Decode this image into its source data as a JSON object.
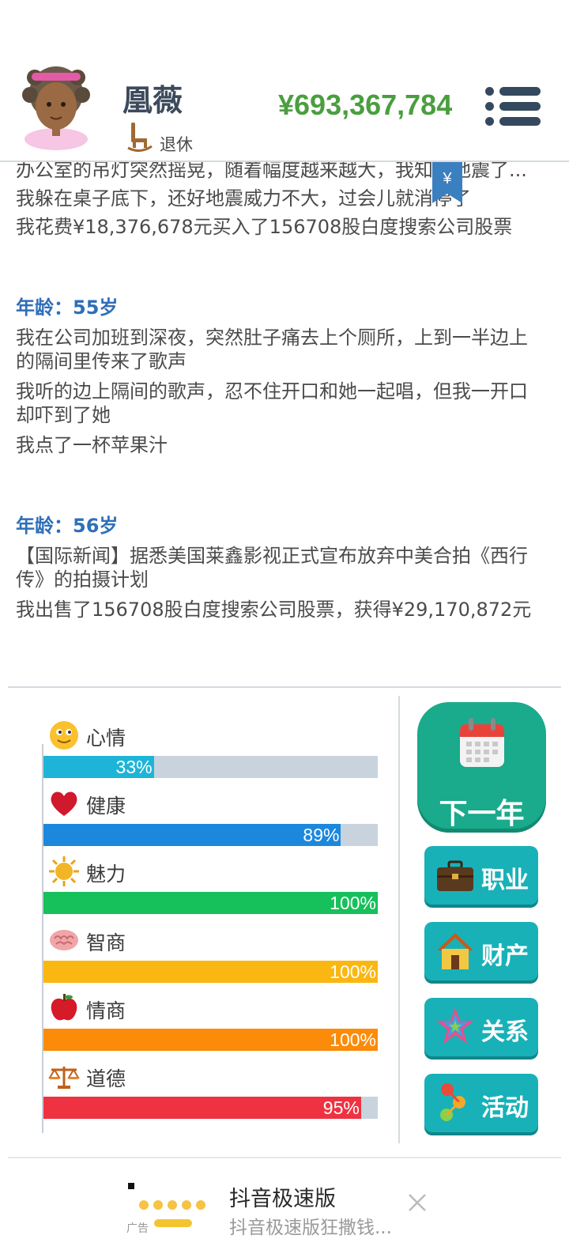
{
  "profile": {
    "name": "凰薇",
    "status": "退休",
    "money": "¥693,367,784"
  },
  "log": {
    "entries": [
      {
        "age": "",
        "lines": [
          "办公室的吊灯突然摇晃，随着幅度越来越大，我知道地震了...",
          "我躲在桌子底下，还好地震威力不大，过会儿就消停了",
          "我花费¥18,376,678元买入了156708股白度搜索公司股票"
        ]
      },
      {
        "age": "年龄：55岁",
        "lines": [
          "我在公司加班到深夜，突然肚子痛去上个厕所，上到一半边上的隔间里传来了歌声",
          "我听的边上隔间的歌声，忍不住开口和她一起唱，但我一开口却吓到了她",
          "我点了一杯苹果汁"
        ]
      },
      {
        "age": "年龄：56岁",
        "lines": [
          "【国际新闻】据悉美国莱鑫影视正式宣布放弃中美合拍《西行传》的拍摄计划",
          "我出售了156708股白度搜索公司股票，获得¥29,170,872元"
        ]
      }
    ],
    "bookmark_symbol": "¥"
  },
  "stats": [
    {
      "label": "心情",
      "value": 33,
      "text": "33%",
      "color": "#1eb4d8",
      "icon": "smiley-icon"
    },
    {
      "label": "健康",
      "value": 89,
      "text": "89%",
      "color": "#1c88dd",
      "icon": "heart-icon"
    },
    {
      "label": "魅力",
      "value": 100,
      "text": "100%",
      "color": "#16c05a",
      "icon": "sun-icon"
    },
    {
      "label": "智商",
      "value": 100,
      "text": "100%",
      "color": "#fbb711",
      "icon": "brain-icon"
    },
    {
      "label": "情商",
      "value": 100,
      "text": "100%",
      "color": "#fb8b09",
      "icon": "apple-icon"
    },
    {
      "label": "道德",
      "value": 95,
      "text": "95%",
      "color": "#ef3241",
      "icon": "scale-icon"
    }
  ],
  "buttons": {
    "next_year": "下一年",
    "career": "职业",
    "assets": "财产",
    "relations": "关系",
    "activities": "活动"
  },
  "ad": {
    "title": "抖音极速版",
    "subtitle": "抖音极速版狂撒钱...",
    "label": "广告"
  }
}
